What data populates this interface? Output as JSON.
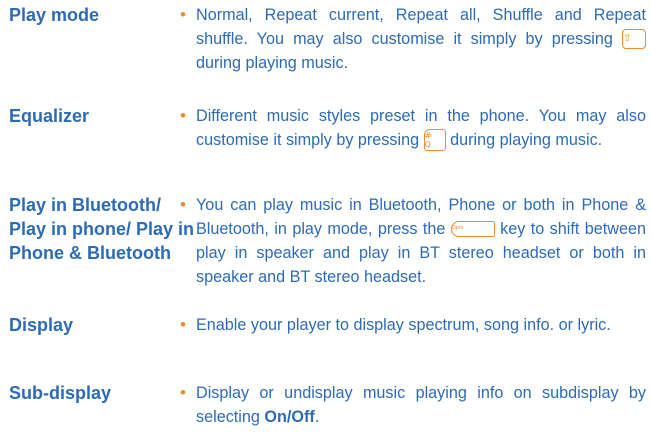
{
  "colors": {
    "text": "#2d6bb5",
    "accent": "#f08a2c"
  },
  "entries": [
    {
      "term": "Play mode",
      "bullet": "•",
      "text_a": "Normal, Repeat current, Repeat all, Shuffle and Repeat shuffle. You may also customise it simply by pressing ",
      "icon": "navigation-up-key-icon",
      "icon_glyph": "⇧",
      "text_b": " during playing music."
    },
    {
      "term": "Equalizer",
      "bullet": "•",
      "text_a": "Different music styles preset in the phone. You may also customise it simply by pressing ",
      "icon": "hash-key-icon",
      "icon_glyph_top": "#",
      "icon_glyph_bottom": "Q",
      "text_b": " during playing music."
    },
    {
      "term": "Play in Bluetooth/ Play in phone/ Play in Phone & Bluetooth",
      "bullet": "•",
      "text_a": "You can play music in Bluetooth, Phone or both in Phone & Bluetooth, in play mode, press the ",
      "icon": "right-softkey-icon",
      "icon_glyph": "Opts",
      "text_b": " key to shift between play in speaker and play in BT stereo headset or both in speaker and BT stereo headset."
    },
    {
      "term": "Display",
      "bullet": "•",
      "text_a": "Enable your player to display spectrum, song info. or lyric."
    },
    {
      "term": "Sub-display",
      "bullet": "•",
      "text_a": "Display or undisplay music playing info on subdisplay by selecting ",
      "text_bold": "On/Off",
      "text_b": "."
    }
  ]
}
